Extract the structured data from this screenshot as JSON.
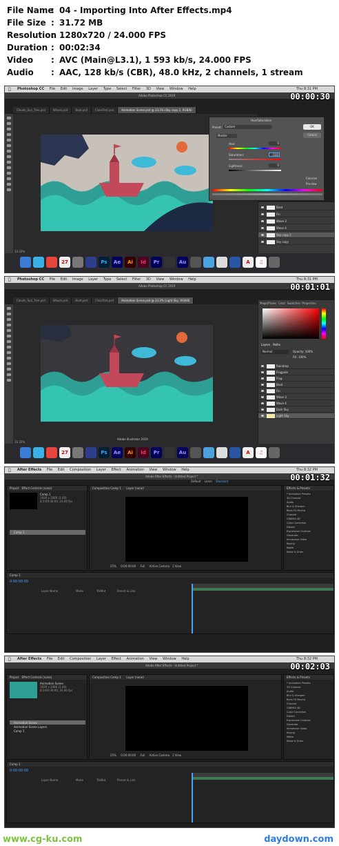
{
  "info": {
    "file_name": {
      "key": "File Name",
      "value": "04 - Importing Into After Effects.mp4"
    },
    "file_size": {
      "key": "File Size",
      "value": "31.72 MB"
    },
    "resolution": {
      "key": "Resolution",
      "value": "1280x720 / 24.000 FPS"
    },
    "duration": {
      "key": "Duration",
      "value": "00:02:34"
    },
    "video": {
      "key": "Video",
      "value": "AVC (Main@L3.1), 1 593 kb/s, 24.000 FPS"
    },
    "audio": {
      "key": "Audio",
      "value": "AAC, 128 kb/s (CBR), 48.0 kHz, 2 channels, 1 stream"
    },
    "separator": ":"
  },
  "frames": {
    "f1": {
      "timestamp": "00:00:30",
      "app": "Photoshop CC",
      "menu": [
        "File",
        "Edit",
        "Image",
        "Layer",
        "Type",
        "Select",
        "Filter",
        "3D",
        "View",
        "Window",
        "Help"
      ],
      "clock": "Thu 8:31 PM",
      "window_title": "Adobe Photoshop CC 2019",
      "tabs": [
        "Clouds_Sun_Tree.psd",
        "Waves.psd",
        "Boat.psd",
        "ClassText.psd",
        "Animation Scene.psd @ 33.3% (Sky copy 2, RGB/8)"
      ],
      "dialog": {
        "title": "Hue/Saturation",
        "preset_label": "Preset:",
        "preset_value": "Custom",
        "channel": "Master",
        "hue_label": "Hue:",
        "hue_value": "0",
        "saturation_label": "Saturation:",
        "saturation_value": "-100",
        "lightness_label": "Lightness:",
        "lightness_value": "0",
        "ok": "OK",
        "cancel": "Cancel",
        "colorize": "Colorize",
        "preview": "Preview"
      },
      "layers": [
        "Boat",
        "Fin",
        "Wave 3",
        "Wave 4",
        "Sky copy 2",
        "Sky copy"
      ]
    },
    "f2": {
      "timestamp": "00:01:01",
      "app": "Photoshop CC",
      "menu": [
        "File",
        "Edit",
        "Image",
        "Layer",
        "Type",
        "Select",
        "Filter",
        "3D",
        "View",
        "Window",
        "Help"
      ],
      "clock": "Thu 8:31 PM",
      "window_title": "Adobe Photoshop CC 2019",
      "tabs": [
        "Clouds_Sun_Tree.psd",
        "Waves.psd",
        "Boat.psd",
        "ClassText.psd",
        "Animation Scene.psd @ 33.3% (Light Sky, RGB/8)"
      ],
      "panel_tabs": [
        "Mage/Picker",
        "Color",
        "Swatches",
        "Properties"
      ],
      "layers_tabs": [
        "Layers",
        "Paths"
      ],
      "blend_mode": "Normal",
      "opacity_label": "Opacity: 100%",
      "fill_label": "Fill: 100%",
      "layers": [
        "Raindrop",
        "Flagpole",
        "Flag",
        "Boat",
        "Fin",
        "Wave 3",
        "Wave 4",
        "Dark Sky",
        "Light Sky"
      ],
      "illustrator_label": "Adobe Illustrator 2019"
    },
    "f3": {
      "timestamp": "00:01:32",
      "app": "After Effects",
      "menu": [
        "File",
        "Edit",
        "Composition",
        "Layer",
        "Effect",
        "Animation",
        "View",
        "Window",
        "Help"
      ],
      "clock": "Thu 8:32 PM",
      "window_title": "Adobe After Effects - Untitled Project *",
      "workspaces": [
        "Default",
        "Learn",
        "Standard"
      ],
      "project_label": "Project",
      "effect_controls": "Effect Controls (none)",
      "comp_name": "Comp 1",
      "comp_info": "1920 x 1080 (1.00)",
      "comp_duration": "Δ 0:00:30:00, 24.00 fps",
      "composition_tab": "Composition Comp 1",
      "layer_tab": "Layer (none)",
      "project_items": [
        "Comp 1"
      ],
      "effects_title": "Effects & Presets",
      "effects": [
        "* Animation Presets",
        "3D Channel",
        "Audio",
        "Blur & Sharpen",
        "Boris FX Mocha",
        "Channel",
        "CINEMA 4D",
        "Color Correction",
        "Distort",
        "Expression Controls",
        "Generate",
        "Immersive Video",
        "Keying",
        "Matte",
        "Noise & Grain"
      ],
      "zoom": "25%",
      "quality": "Full",
      "camera": "Active Camera",
      "views": "1 View",
      "timecode": "0:00:00:00",
      "timeline_tab": "Comp 1",
      "col_layer_name": "Layer Name",
      "col_mode": "Mode",
      "col_trkmat": "TrkMat",
      "col_parent": "Parent & Link"
    },
    "f4": {
      "timestamp": "00:02:03",
      "app": "After Effects",
      "menu": [
        "File",
        "Edit",
        "Composition",
        "Layer",
        "Effect",
        "Animation",
        "View",
        "Window",
        "Help"
      ],
      "clock": "Thu 8:32 PM",
      "window_title": "Adobe After Effects - Untitled Project *",
      "comp_name": "Animation Scene",
      "comp_info": "1920 x 1080 (1.00)",
      "comp_duration": "Δ 0:00:30:00, 24.00 fps",
      "project_items": [
        "Animation Scene",
        "Animation Scene Layers",
        "Comp 1"
      ],
      "effects": [
        "* Animation Presets",
        "3D Channel",
        "Audio",
        "Blur & Sharpen",
        "Boris FX Mocha",
        "Channel",
        "CINEMA 4D",
        "Color Correction",
        "Distort",
        "Expression Controls",
        "Generate",
        "Immersive Video",
        "Keying",
        "Matte",
        "Noise & Grain"
      ]
    }
  },
  "watermarks": {
    "left": "www.cg-ku.com",
    "right": "daydown.com"
  }
}
